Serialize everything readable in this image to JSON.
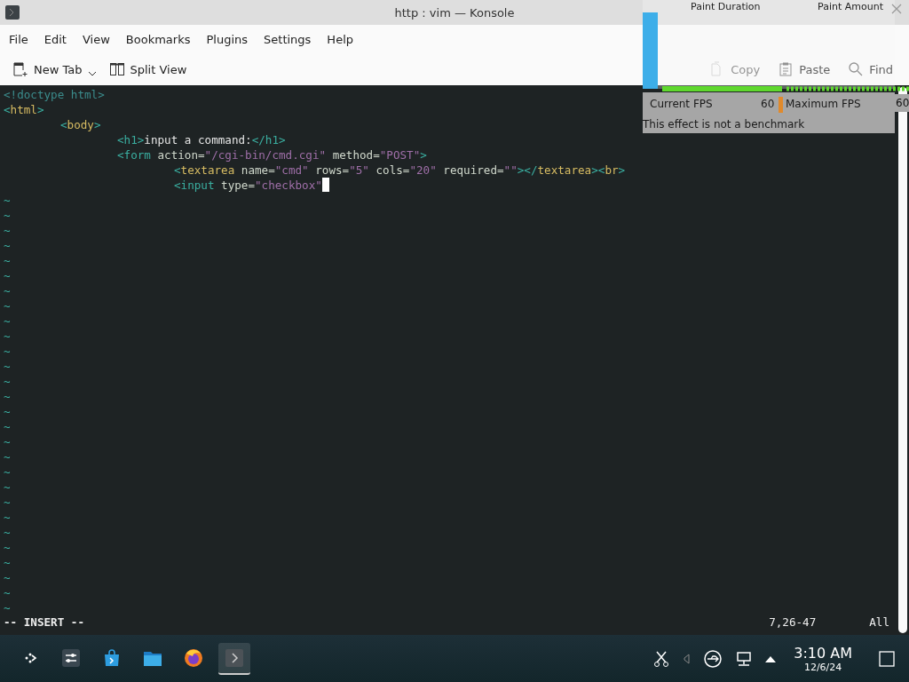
{
  "window": {
    "title": "http : vim — Konsole"
  },
  "menu": [
    "File",
    "Edit",
    "View",
    "Bookmarks",
    "Plugins",
    "Settings",
    "Help"
  ],
  "toolbar": [
    {
      "kind": "new-tab",
      "label": "New Tab",
      "disabled": false
    },
    {
      "kind": "split",
      "label": "Split View",
      "disabled": false
    }
  ],
  "toolbar_right": [
    {
      "kind": "copy",
      "label": "Copy",
      "disabled": true
    },
    {
      "kind": "paste",
      "label": "Paste",
      "disabled": false
    },
    {
      "kind": "find",
      "label": "Find",
      "disabled": false
    }
  ],
  "editor": {
    "lines": [
      {
        "segments": [
          {
            "kind": "comment",
            "text": "<!doctype html>"
          }
        ]
      },
      {
        "segments": [
          {
            "kind": "punct",
            "text": "<"
          },
          {
            "kind": "tag",
            "text": "html"
          },
          {
            "kind": "punct",
            "text": ">"
          }
        ],
        "children": [
          {
            "segments": [
              {
                "kind": "punct",
                "text": "<"
              },
              {
                "kind": "tag",
                "text": "body"
              },
              {
                "kind": "punct",
                "text": ">"
              }
            ],
            "children": [
              {
                "segments": [
                  {
                    "kind": "punct",
                    "text": "<h1>"
                  },
                  {
                    "kind": "text",
                    "text": "input a command:"
                  },
                  {
                    "kind": "punct",
                    "text": "</h1>"
                  }
                ]
              },
              {
                "segments": [
                  {
                    "kind": "punct",
                    "text": "<form"
                  },
                  {
                    "kind": "attr",
                    "text": " action="
                  },
                  {
                    "kind": "string",
                    "text": "\"/cgi-bin/cmd.cgi\""
                  },
                  {
                    "kind": "attr",
                    "text": " method="
                  },
                  {
                    "kind": "string",
                    "text": "\"POST\""
                  },
                  {
                    "kind": "punct",
                    "text": ">"
                  }
                ],
                "children": [
                  {
                    "segments": [
                      {
                        "kind": "punct",
                        "text": "<"
                      },
                      {
                        "kind": "tag",
                        "text": "textarea"
                      },
                      {
                        "kind": "attr",
                        "text": " name="
                      },
                      {
                        "kind": "string",
                        "text": "\"cmd\""
                      },
                      {
                        "kind": "attr",
                        "text": " rows="
                      },
                      {
                        "kind": "string",
                        "text": "\"5\""
                      },
                      {
                        "kind": "attr",
                        "text": " cols="
                      },
                      {
                        "kind": "string",
                        "text": "\"20\""
                      },
                      {
                        "kind": "attr",
                        "text": " required="
                      },
                      {
                        "kind": "string",
                        "text": "\"\""
                      },
                      {
                        "kind": "punct",
                        "text": "></"
                      },
                      {
                        "kind": "tag",
                        "text": "textarea"
                      },
                      {
                        "kind": "punct",
                        "text": "><"
                      },
                      {
                        "kind": "tag",
                        "text": "br"
                      },
                      {
                        "kind": "punct",
                        "text": ">"
                      }
                    ]
                  },
                  {
                    "segments": [
                      {
                        "kind": "punct",
                        "text": "<input"
                      },
                      {
                        "kind": "attr",
                        "text": " type="
                      },
                      {
                        "kind": "string",
                        "text": "\"checkbox\""
                      }
                    ],
                    "cursor": true
                  }
                ]
              }
            ]
          }
        ]
      }
    ],
    "empty_lines": [
      "~",
      "~",
      "~",
      "~",
      "~",
      "~",
      "~",
      "~",
      "~",
      "~",
      "~",
      "~",
      "~",
      "~",
      "~",
      "~",
      "~",
      "~",
      "~",
      "~",
      "~",
      "~",
      "~",
      "~",
      "~",
      "~",
      "~",
      "~"
    ],
    "mode": "-- INSERT --",
    "position": "7,26-47",
    "scroll": "All"
  },
  "fps_overlay": {
    "paint_duration": "Paint Duration",
    "paint_amount": "Paint Amount",
    "current_label": "Current FPS",
    "current_value": "60",
    "max_label": "Maximum FPS",
    "max_value": "60",
    "note": "This effect is not a benchmark"
  },
  "taskbar": {
    "apps": [
      {
        "kind": "launcher",
        "selected": false
      },
      {
        "kind": "settings",
        "selected": false
      },
      {
        "kind": "store",
        "selected": false
      },
      {
        "kind": "files",
        "selected": false
      },
      {
        "kind": "browser",
        "selected": false
      },
      {
        "kind": "terminal",
        "selected": true
      }
    ],
    "time": "3:10 AM",
    "date": "12/6/24"
  }
}
